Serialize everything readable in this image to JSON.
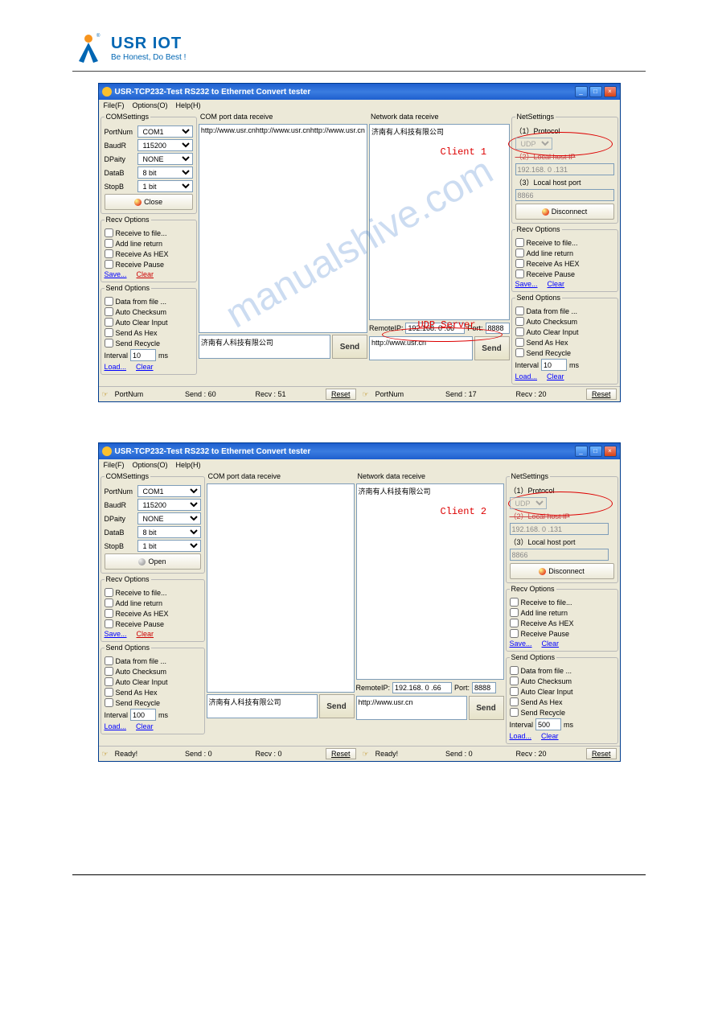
{
  "logo": {
    "title": "USR IOT",
    "subtitle": "Be Honest, Do Best !"
  },
  "titlebar": "USR-TCP232-Test  RS232 to Ethernet Convert tester",
  "menu": {
    "file": "File(F)",
    "options": "Options(O)",
    "help": "Help(H)"
  },
  "com": {
    "legend": "COMSettings",
    "portnum_l": "PortNum",
    "portnum_v": "COM1",
    "baud_l": "BaudR",
    "baud_v": "115200",
    "parity_l": "DPaity",
    "parity_v": "NONE",
    "datab_l": "DataB",
    "datab_v": "8 bit",
    "stopb_l": "StopB",
    "stopb_v": "1 bit",
    "close": "Close",
    "open": "Open"
  },
  "recv": {
    "legend": "Recv Options",
    "tofile": "Receive to file...",
    "addline": "Add line return",
    "ashex": "Receive As HEX",
    "pause": "Receive Pause",
    "save": "Save...",
    "clear": "Clear"
  },
  "send": {
    "legend": "Send Options",
    "fromfile": "Data from file ...",
    "checksum": "Auto Checksum",
    "clearinput": "Auto Clear Input",
    "ashex": "Send As Hex",
    "recycle": "Send Recycle",
    "interval_l": "Interval",
    "interval_v1": "10",
    "interval_v2": "100",
    "interval_v3": "500",
    "ms": "ms",
    "load": "Load...",
    "clear": "Clear"
  },
  "comdata": {
    "legend": "COM port data receive",
    "rx1": "http://www.usr.cnhttp://www.usr.cnhttp://www.usr.cn",
    "rx2": "",
    "tx": "济南有人科技有限公司",
    "send": "Send"
  },
  "netdata": {
    "legend": "Network data receive",
    "rx": "济南有人科技有限公司",
    "remoteip_l": "RemoteIP:",
    "remoteip_v": "192.168. 0 .66",
    "port_l": "Port:",
    "port_v": "8888",
    "tx": "http://www.usr.cn",
    "send": "Send"
  },
  "net": {
    "legend": "NetSettings",
    "proto_l": "（1）Protocol",
    "proto_v": "UDP",
    "hostip_l": "（2）Local host IP",
    "hostip_v": "192.168. 0 .131",
    "hostport_l": "（3）Local host port",
    "hostport_v": "8866",
    "disconnect": "Disconnect"
  },
  "status1": {
    "left": "PortNum",
    "send": "Send : 60",
    "recv": "Recv : 51",
    "reset": "Reset",
    "right_left": "PortNum",
    "right_send": "Send : 17",
    "right_recv": "Recv : 20"
  },
  "status2": {
    "left": "Ready!",
    "send": "Send : 0",
    "recv": "Recv : 0",
    "reset": "Reset",
    "right_left": "Ready!",
    "right_send": "Send : 0",
    "right_recv": "Recv : 20"
  },
  "callouts": {
    "client1": "Client 1",
    "client2": "Client 2",
    "udpserver": "UDP Server"
  },
  "ready_icon": "✓"
}
